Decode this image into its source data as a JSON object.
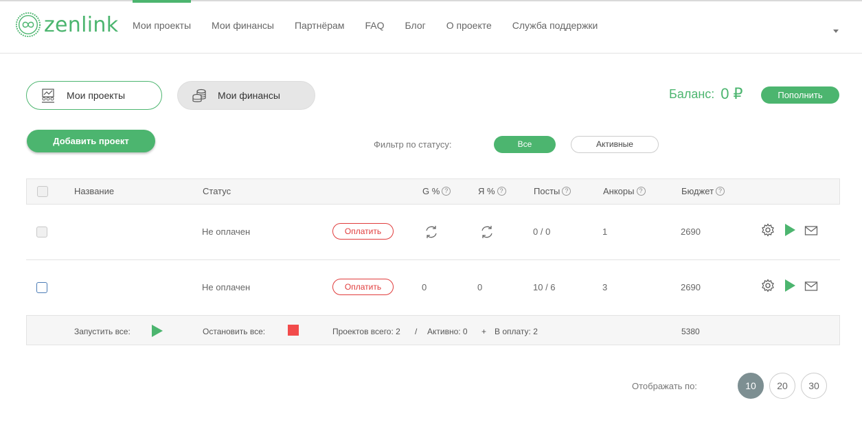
{
  "logo": {
    "text": "zenlink"
  },
  "nav": {
    "items": [
      "Мои проекты",
      "Мои финансы",
      "Партнёрам",
      "FAQ",
      "Блог",
      "О проекте",
      "Служба поддержки"
    ],
    "active_index": 0
  },
  "tabs": {
    "projects": "Мои проекты",
    "finance": "Мои финансы"
  },
  "balance": {
    "label": "Баланс:",
    "value": "0",
    "currency": "₽",
    "topup": "Пополнить"
  },
  "add_project": "Добавить проект",
  "filter": {
    "label": "Фильтр по статусу:",
    "all": "Все",
    "active": "Активные"
  },
  "table": {
    "headers": {
      "name": "Название",
      "status": "Статус",
      "g": "G %",
      "ya": "Я %",
      "posts": "Посты",
      "anchors": "Анкоры",
      "budget": "Бюджет"
    },
    "help_glyph": "?",
    "rows": [
      {
        "status": "Не оплачен",
        "pay": "Оплатить",
        "posts": "0 / 0",
        "anchors": "1",
        "budget": "2690"
      },
      {
        "status": "Не оплачен",
        "pay": "Оплатить",
        "g": "0",
        "ya": "0",
        "posts": "10 / 6",
        "anchors": "3",
        "budget": "2690"
      }
    ],
    "footer": {
      "run_all": "Запустить все:",
      "stop_all": "Остановить все:",
      "total": "Проектов всего: 2",
      "slash": "/",
      "active": "Активно: 0",
      "plus": "+",
      "to_pay": "В оплату: 2",
      "budget_total": "5380"
    }
  },
  "pagination": {
    "label": "Отображать по:",
    "options": [
      "10",
      "20",
      "30"
    ],
    "selected": "10"
  },
  "colors": {
    "accent": "#4cb56f",
    "danger": "#e03b3b",
    "stop": "#f24b4b",
    "page_selected": "#7d8f92"
  },
  "icons": {
    "row_actions": [
      "gear-icon",
      "play-icon",
      "mail-icon"
    ],
    "sync": "refresh-icon"
  }
}
